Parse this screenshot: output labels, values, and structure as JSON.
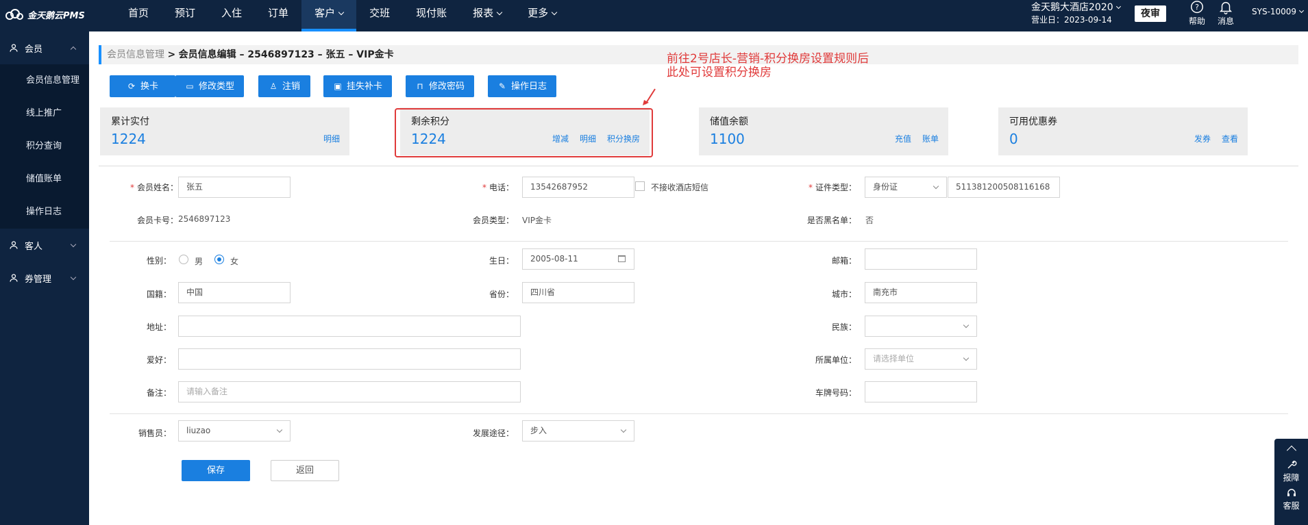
{
  "brand": {
    "name": "金天鹅云PMS"
  },
  "nav": [
    {
      "label": "首页",
      "dropdown": false
    },
    {
      "label": "预订",
      "dropdown": false
    },
    {
      "label": "入住",
      "dropdown": false
    },
    {
      "label": "订单",
      "dropdown": false
    },
    {
      "label": "客户",
      "dropdown": true,
      "active": true
    },
    {
      "label": "交班",
      "dropdown": false
    },
    {
      "label": "现付账",
      "dropdown": false
    },
    {
      "label": "报表",
      "dropdown": true
    },
    {
      "label": "更多",
      "dropdown": true
    }
  ],
  "header": {
    "hotel_name": "金天鹅大酒店2020",
    "business_day": "营业日：2023-09-14",
    "night_audit": "夜审",
    "help": "帮助",
    "messages": "消息",
    "user": "SYS-10009"
  },
  "sidebar": {
    "member_group": "会员",
    "member_items": [
      "会员信息管理",
      "线上推广",
      "积分查询",
      "储值账单",
      "操作日志"
    ],
    "guest_group": "客人",
    "coupon_group": "券管理"
  },
  "breadcrumb": {
    "parent": "会员信息管理",
    "separator": ">",
    "current": "会员信息编辑 – 2546897123 – 张五 – VIP金卡"
  },
  "toolbar": {
    "change_card": "换卡",
    "change_type": "修改类型",
    "cancel": "注销",
    "report_loss": "挂失补卡",
    "change_password": "修改密码",
    "operation_log": "操作日志"
  },
  "cards": {
    "paid": {
      "title": "累计实付",
      "value": "1224",
      "link1": "明细"
    },
    "points": {
      "title": "剩余积分",
      "value": "1224",
      "link1": "增减",
      "link2": "明细",
      "link3": "积分换房"
    },
    "balance": {
      "title": "储值余额",
      "value": "1100",
      "link1": "充值",
      "link2": "账单"
    },
    "coupons": {
      "title": "可用优惠券",
      "value": "0",
      "link1": "发券",
      "link2": "查看"
    }
  },
  "annotation": {
    "line1": "前往2号店长-营销-积分换房设置规则后",
    "line2": "此处可设置积分换房"
  },
  "form": {
    "name_label": "会员姓名：",
    "name_value": "张五",
    "phone_label": "电话：",
    "phone_value": "13542687952",
    "no_sms_label": "不接收酒店短信",
    "id_type_label": "证件类型：",
    "id_type_value": "身份证",
    "id_number": "511381200508116168",
    "card_no_label": "会员卡号：",
    "card_no_value": "2546897123",
    "member_type_label": "会员类型：",
    "member_type_value": "VIP金卡",
    "blacklist_label": "是否黑名单：",
    "blacklist_value": "否",
    "gender_label": "性别：",
    "gender_male": "男",
    "gender_female": "女",
    "gender_selected": "女",
    "birthday_label": "生日：",
    "birthday_value": "2005-08-11",
    "email_label": "邮箱：",
    "email_value": "",
    "nationality_label": "国籍：",
    "nationality_value": "中国",
    "province_label": "省份：",
    "province_value": "四川省",
    "city_label": "城市：",
    "city_value": "南充市",
    "address_label": "地址：",
    "address_value": "",
    "ethnicity_label": "民族：",
    "ethnicity_value": "",
    "hobby_label": "爱好：",
    "hobby_value": "",
    "unit_label": "所属单位：",
    "unit_placeholder": "请选择单位",
    "remark_label": "备注：",
    "remark_placeholder": "请输入备注",
    "plate_label": "车牌号码：",
    "plate_value": "",
    "sales_label": "销售员：",
    "sales_value": "liuzao",
    "channel_label": "发展途径：",
    "channel_value": "步入"
  },
  "actions": {
    "save": "保存",
    "back": "返回"
  },
  "float_panel": {
    "report": "报障",
    "service": "客服"
  },
  "colors": {
    "nav_bg": "#0f2440",
    "accent": "#1a7fe0",
    "annotation": "#e03a3a"
  }
}
